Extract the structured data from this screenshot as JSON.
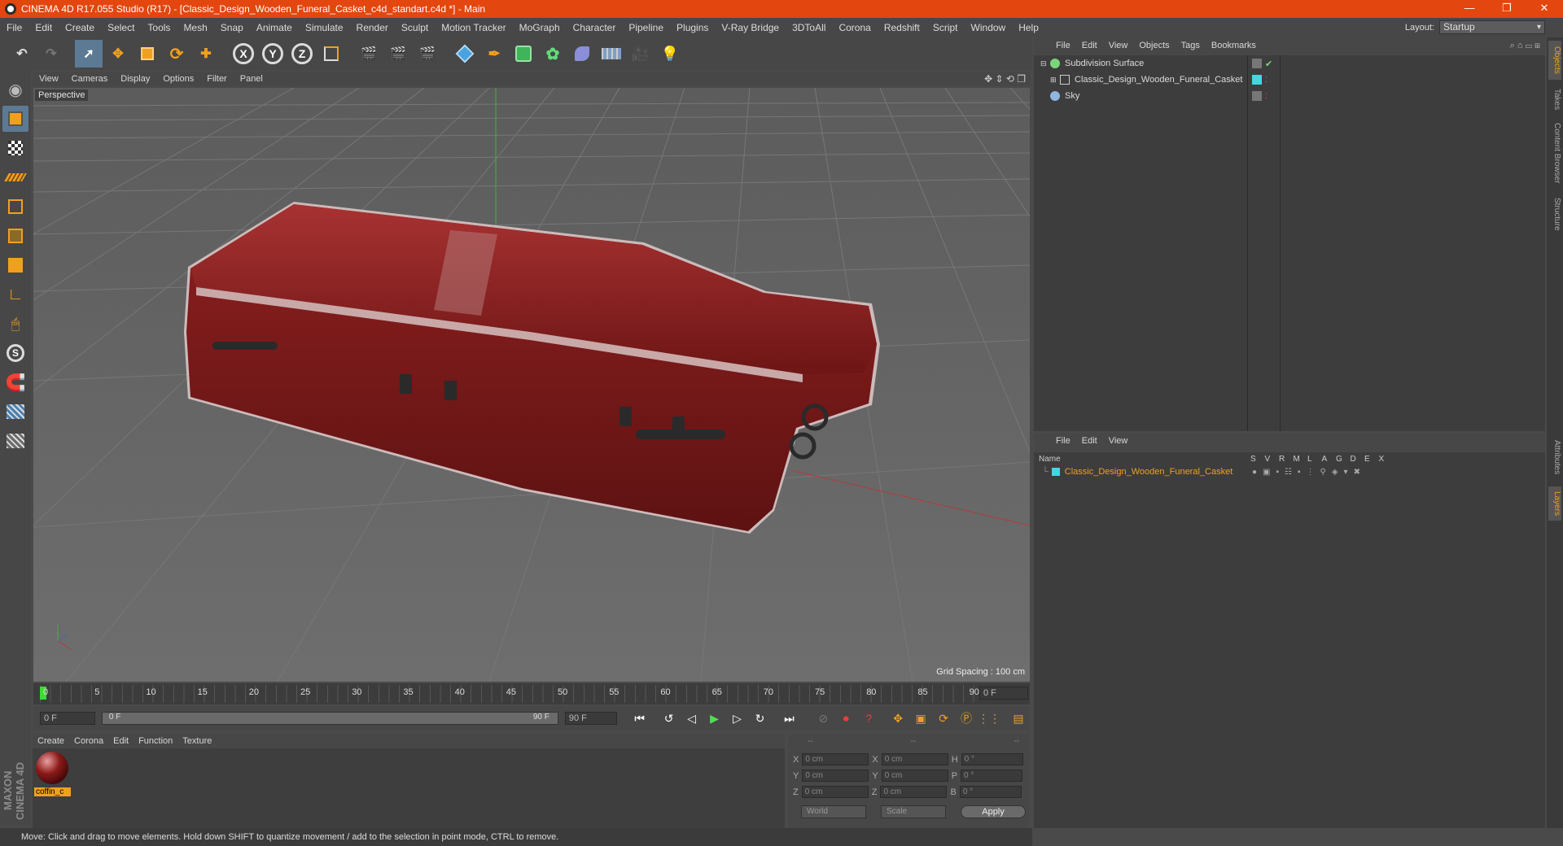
{
  "window": {
    "title": "CINEMA 4D R17.055 Studio (R17) - [Classic_Design_Wooden_Funeral_Casket_c4d_standart.c4d *] - Main"
  },
  "menu": [
    "File",
    "Edit",
    "Create",
    "Select",
    "Tools",
    "Mesh",
    "Snap",
    "Animate",
    "Simulate",
    "Render",
    "Sculpt",
    "Motion Tracker",
    "MoGraph",
    "Character",
    "Pipeline",
    "Plugins",
    "V-Ray Bridge",
    "3DToAll",
    "Corona",
    "Redshift",
    "Script",
    "Window",
    "Help"
  ],
  "layout": {
    "label": "Layout:",
    "value": "Startup"
  },
  "viewport": {
    "menu": [
      "View",
      "Cameras",
      "Display",
      "Options",
      "Filter",
      "Panel"
    ],
    "camera_label": "Perspective",
    "grid_spacing": "Grid Spacing : 100 cm"
  },
  "timeline": {
    "ticks": [
      "0",
      "5",
      "10",
      "15",
      "20",
      "25",
      "30",
      "35",
      "40",
      "45",
      "50",
      "55",
      "60",
      "65",
      "70",
      "75",
      "80",
      "85",
      "90"
    ],
    "current_frame": "0 F",
    "start_field": "0 F",
    "slider_start": "0 F",
    "slider_end": "90 F",
    "end_field": "90 F"
  },
  "materials": {
    "menu": [
      "Create",
      "Corona",
      "Edit",
      "Function",
      "Texture"
    ],
    "items": [
      {
        "label": "coffin_c"
      }
    ]
  },
  "coordinates": {
    "headers": [
      "--",
      "--",
      "--"
    ],
    "rows": [
      {
        "a": "X",
        "av": "0 cm",
        "b": "X",
        "bv": "0 cm",
        "c": "H",
        "cv": "0 °"
      },
      {
        "a": "Y",
        "av": "0 cm",
        "b": "Y",
        "bv": "0 cm",
        "c": "P",
        "cv": "0 °"
      },
      {
        "a": "Z",
        "av": "0 cm",
        "b": "Z",
        "bv": "0 cm",
        "c": "B",
        "cv": "0 °"
      }
    ],
    "mode1": "World",
    "mode2": "Scale",
    "apply": "Apply"
  },
  "status": "Move: Click and drag to move elements. Hold down SHIFT to quantize movement / add to the selection in point mode, CTRL to remove.",
  "brand": "MAXON CINEMA 4D",
  "objects": {
    "menu": [
      "File",
      "Edit",
      "View",
      "Objects",
      "Tags",
      "Bookmarks"
    ],
    "items": [
      {
        "name": "Subdivision Surface",
        "color": "#7bd67b"
      },
      {
        "name": "Classic_Design_Wooden_Funeral_Casket",
        "color": "#44d7e0"
      },
      {
        "name": "Sky",
        "color": "#8fb6dd"
      }
    ]
  },
  "layers": {
    "menu": [
      "File",
      "Edit",
      "View"
    ],
    "headers": [
      "Name",
      "S",
      "V",
      "R",
      "M",
      "L",
      "A",
      "G",
      "D",
      "E",
      "X"
    ],
    "items": [
      {
        "name": "Classic_Design_Wooden_Funeral_Casket",
        "color": "#44d7e0"
      }
    ]
  },
  "sidetabs": [
    "Objects",
    "Takes",
    "Content Browser",
    "Structure",
    "Attributes",
    "Layers"
  ],
  "colors": {
    "title_bar": "#e3460e",
    "accent": "#f0a020",
    "casket": "#8c1c1c"
  }
}
